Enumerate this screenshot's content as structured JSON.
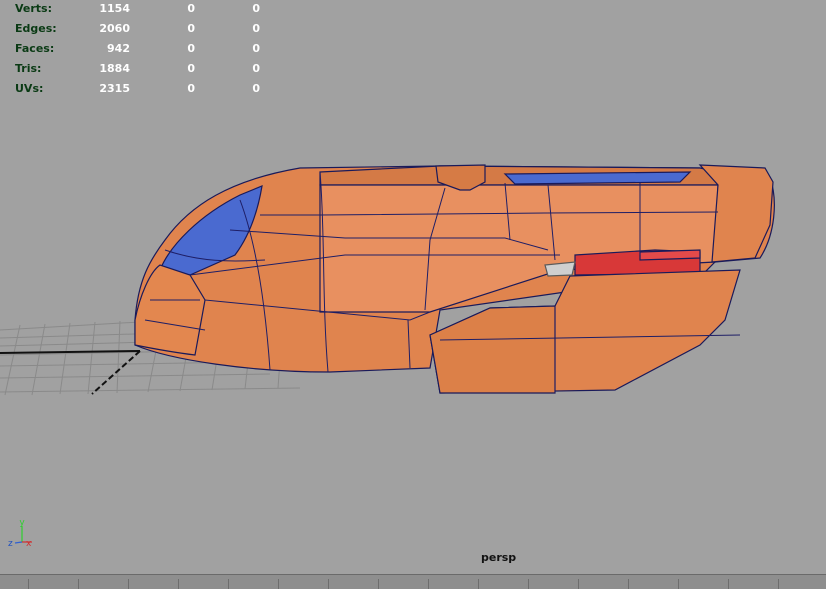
{
  "hud": {
    "rows": [
      {
        "label": "Verts:",
        "v1": "1154",
        "v2": "0",
        "v3": "0"
      },
      {
        "label": "Edges:",
        "v1": "2060",
        "v2": "0",
        "v3": "0"
      },
      {
        "label": "Faces:",
        "v1": "942",
        "v2": "0",
        "v3": "0"
      },
      {
        "label": "Tris:",
        "v1": "1884",
        "v2": "0",
        "v3": "0"
      },
      {
        "label": "UVs:",
        "v1": "2315",
        "v2": "0",
        "v3": "0"
      }
    ]
  },
  "viewport": {
    "camera": "persp",
    "background": "#a1a1a1"
  },
  "axis": {
    "y": "y",
    "z": "z",
    "x": "x"
  },
  "model": {
    "body_color": "#e0844e",
    "glass_color": "#4a6ad0",
    "light_color": "#d83838",
    "wire_color": "#1a1a5a"
  }
}
